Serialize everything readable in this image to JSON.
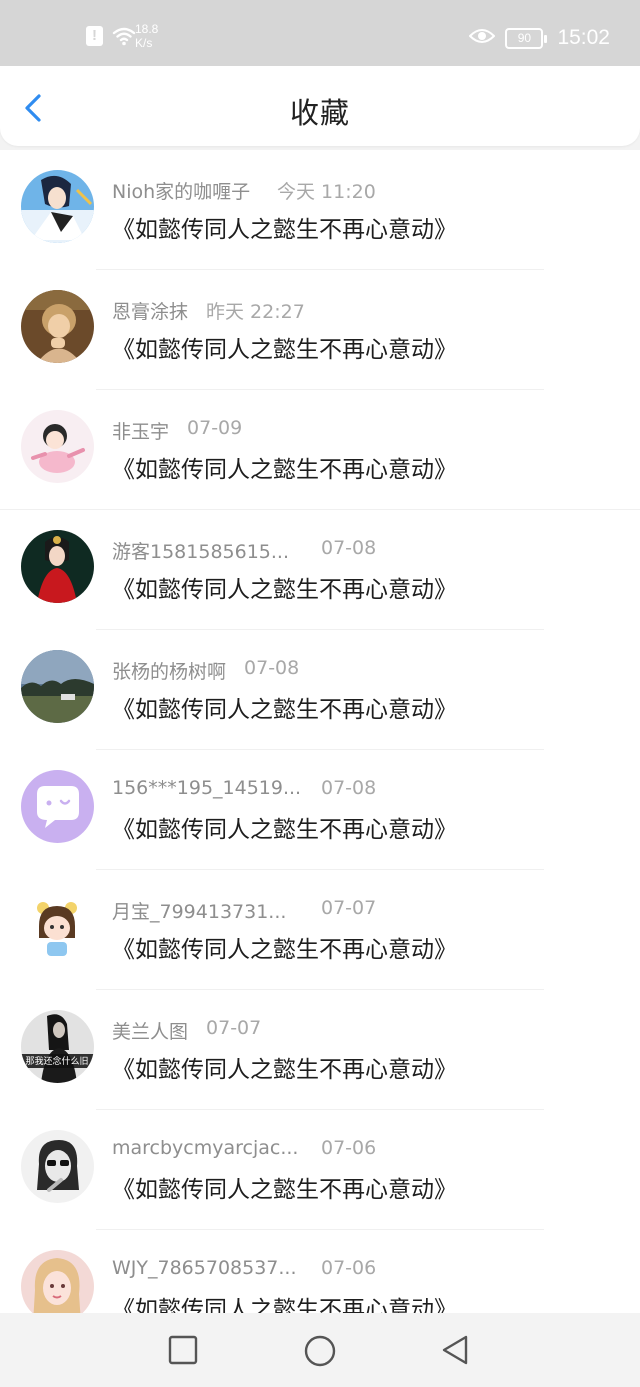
{
  "status_bar": {
    "net_speed_value": "18.8",
    "net_speed_unit": "K/s",
    "battery": "90",
    "time": "15:02",
    "icons": [
      "alert-icon",
      "wifi-icon",
      "eye-icon",
      "battery-icon"
    ]
  },
  "header": {
    "title": "收藏",
    "back_icon": "chevron-left-icon"
  },
  "colors": {
    "accent": "#2f8cf0",
    "status_bar_bg": "#d6d6d6",
    "list_bg": "#ffffff",
    "meta_text": "#8e8e8e",
    "title_text": "#1e1e1e"
  },
  "items": [
    {
      "name": "Nioh家的咖喱子",
      "time": "今天 11:20",
      "title": "《如懿传同人之懿生不再心意动》"
    },
    {
      "name": "恩膏涂抹",
      "time": "昨天 22:27",
      "title": "《如懿传同人之懿生不再心意动》"
    },
    {
      "name": "非玉宇",
      "time": "07-09",
      "title": "《如懿传同人之懿生不再心意动》"
    },
    {
      "name": "游客1581585615...",
      "time": "07-08",
      "title": "《如懿传同人之懿生不再心意动》"
    },
    {
      "name": "张杨的杨树啊",
      "time": "07-08",
      "title": "《如懿传同人之懿生不再心意动》"
    },
    {
      "name": "156***195_14519...",
      "time": "07-08",
      "title": "《如懿传同人之懿生不再心意动》"
    },
    {
      "name": "月宝_799413731...",
      "time": "07-07",
      "title": "《如懿传同人之懿生不再心意动》"
    },
    {
      "name": "美兰人图",
      "time": "07-07",
      "title": "《如懿传同人之懿生不再心意动》",
      "avatar_caption": "那我还念什么旧"
    },
    {
      "name": "marcbycmyarcjac...",
      "time": "07-06",
      "title": "《如懿传同人之懿生不再心意动》"
    },
    {
      "name": "WJY_7865708537...",
      "time": "07-06",
      "title": "《如懿传同人之懿生不再心意动》"
    }
  ],
  "nav_bar": {
    "buttons": [
      "square-icon",
      "circle-icon",
      "triangle-back-icon"
    ]
  }
}
